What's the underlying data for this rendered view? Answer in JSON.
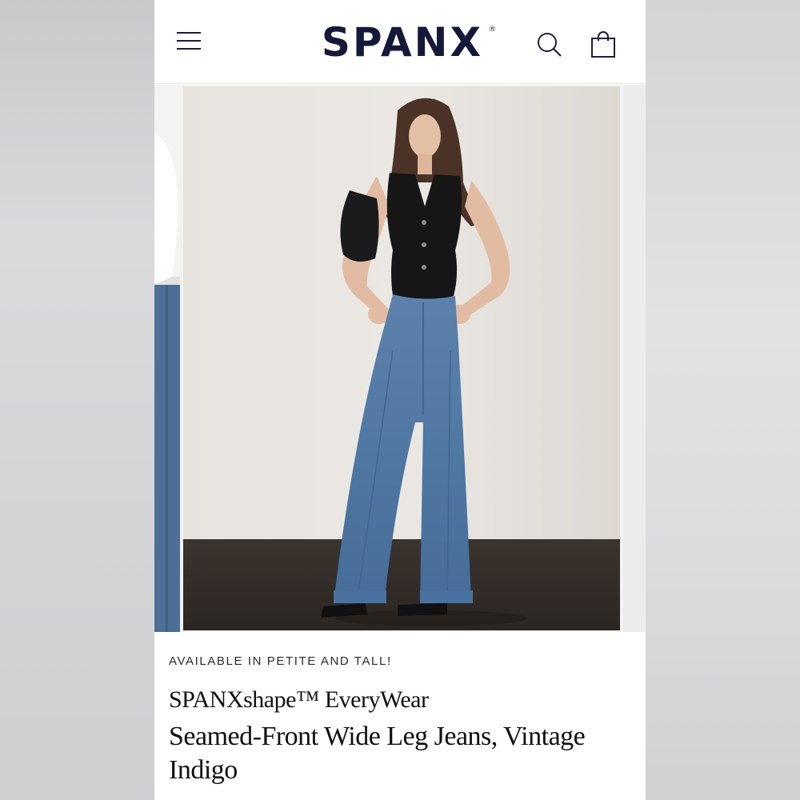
{
  "header": {
    "logo_text": "SPANX",
    "logo_mark": "®",
    "menu_icon": "hamburger-menu-icon",
    "search_icon": "search-icon",
    "bag_icon": "shopping-bag-icon",
    "brand_color": "#14193a"
  },
  "gallery": {
    "main_image": "model-wearing-wide-leg-jeans-and-black-vest"
  },
  "product": {
    "availability": "AVAILABLE IN PETITE AND TALL!",
    "subtitle": "SPANXshape™ EveryWear",
    "title": "Seamed-Front Wide Leg Jeans, Vintage Indigo"
  }
}
